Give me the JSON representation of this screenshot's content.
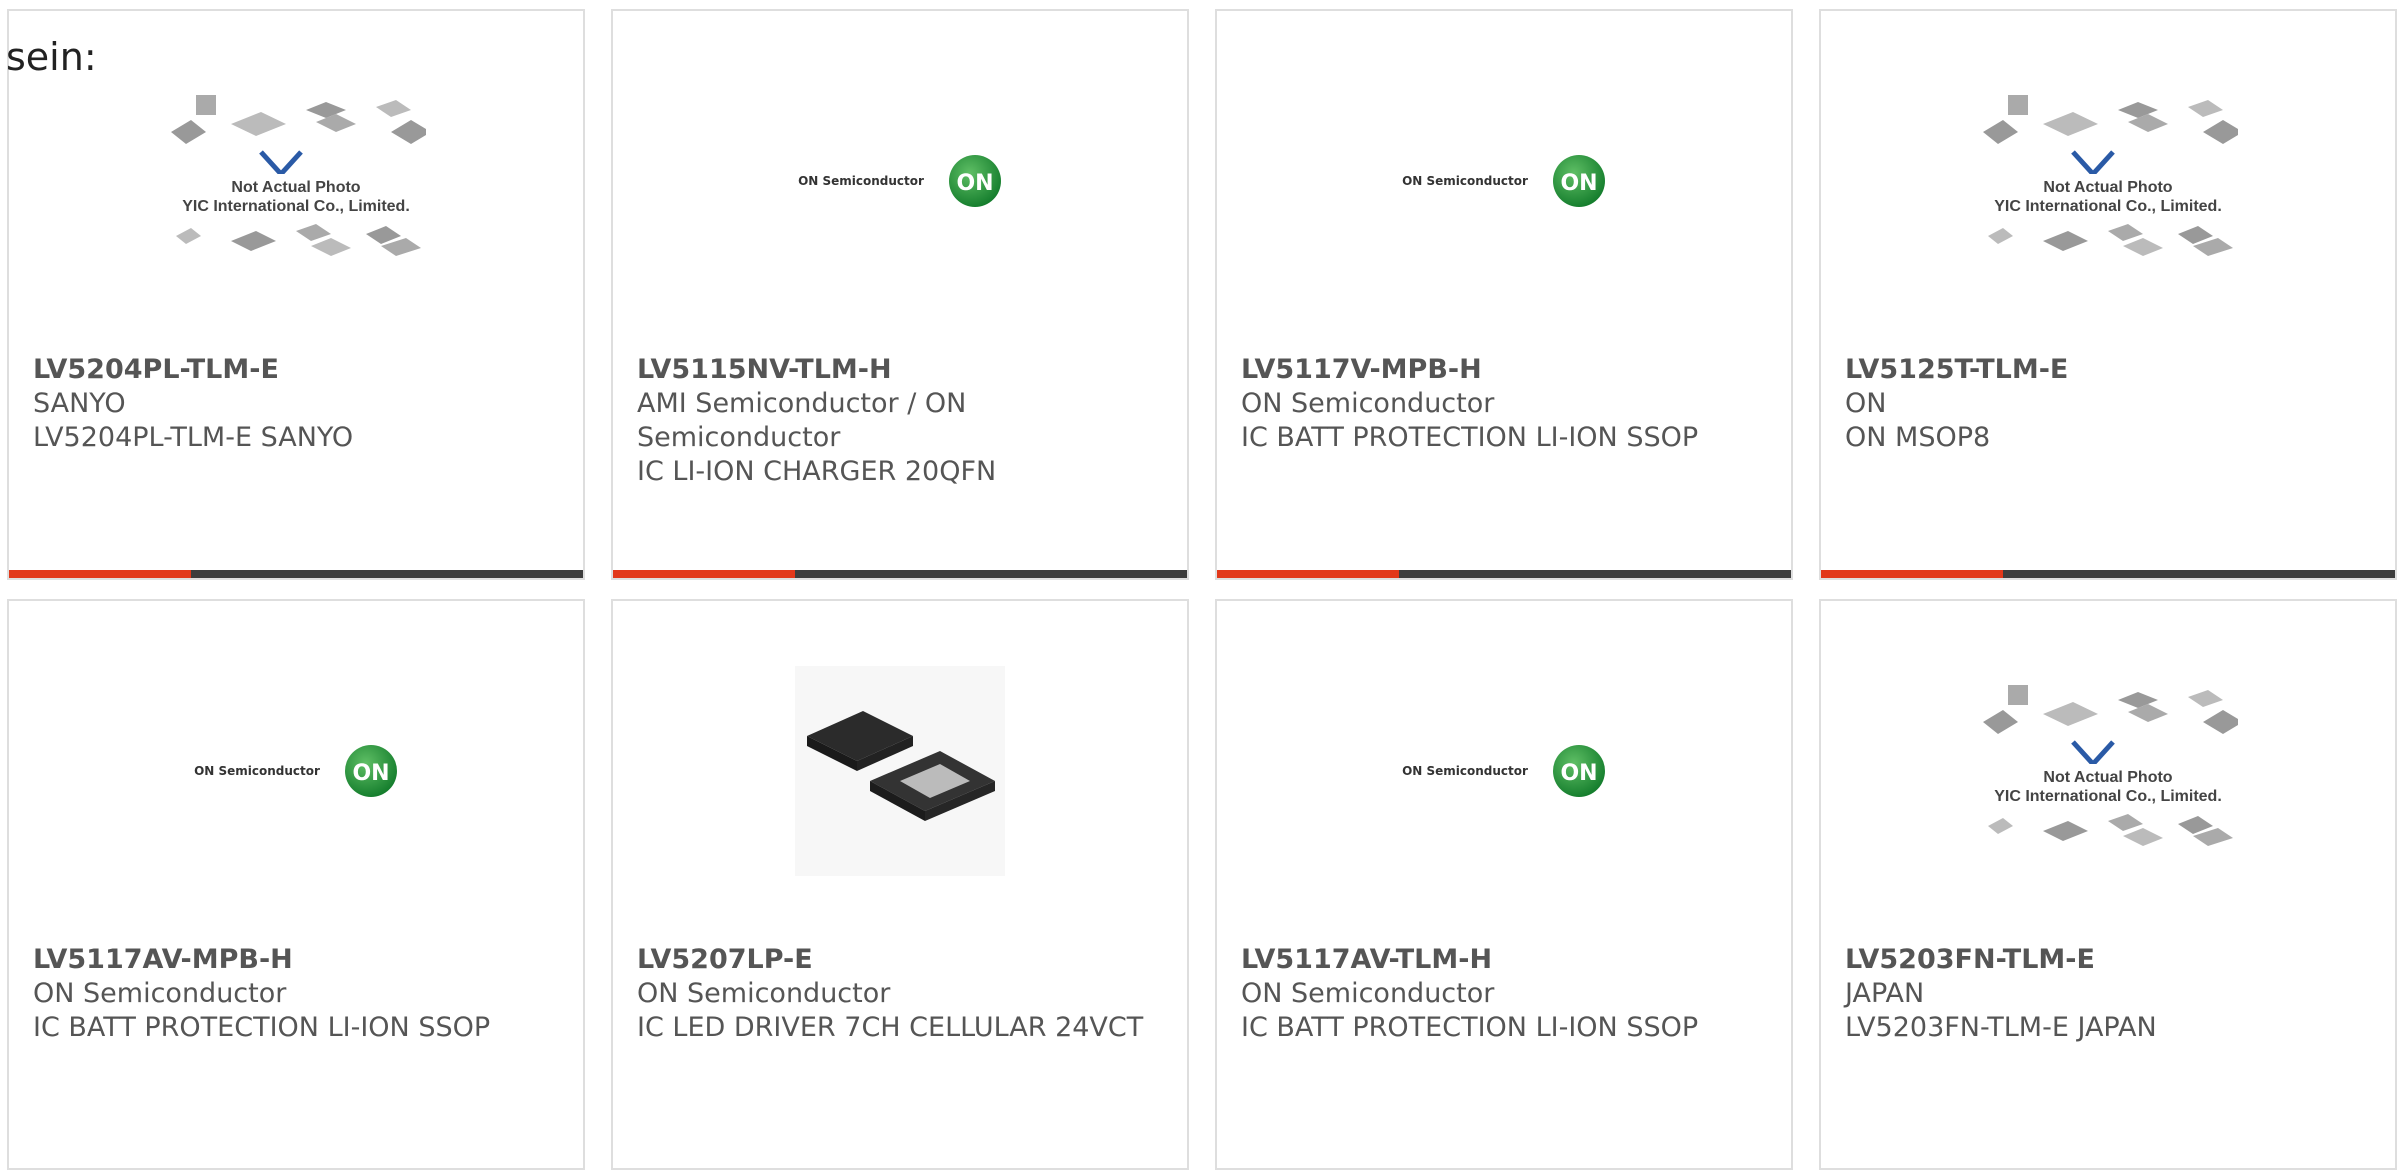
{
  "intro_text": "sein:",
  "placeholder": {
    "line1": "Not Actual Photo",
    "line2": "YIC International Co., Limited."
  },
  "on_logo": {
    "wordmark": "ON Semiconductor",
    "badge": "ON"
  },
  "colors": {
    "accent": "#e2381a",
    "bar": "#3d3d3d",
    "text": "#555555",
    "border": "#dedede"
  },
  "products": [
    {
      "part": "LV5204PL-TLM-E",
      "manufacturer": "SANYO",
      "description": "LV5204PL-TLM-E SANYO",
      "image": "placeholder"
    },
    {
      "part": "LV5115NV-TLM-H",
      "manufacturer": "AMI Semiconductor / ON Semiconductor",
      "description": "IC LI-ION CHARGER 20QFN",
      "image": "on-logo"
    },
    {
      "part": "LV5117V-MPB-H",
      "manufacturer": "ON Semiconductor",
      "description": "IC BATT PROTECTION LI-ION SSOP",
      "image": "on-logo"
    },
    {
      "part": "LV5125T-TLM-E",
      "manufacturer": "ON",
      "description": "ON MSOP8",
      "image": "placeholder"
    },
    {
      "part": "LV5117AV-MPB-H",
      "manufacturer": "ON Semiconductor",
      "description": "IC BATT PROTECTION LI-ION SSOP",
      "image": "on-logo"
    },
    {
      "part": "LV5207LP-E",
      "manufacturer": "ON Semiconductor",
      "description": "IC LED DRIVER 7CH CELLULAR 24VCT",
      "image": "chip-photo"
    },
    {
      "part": "LV5117AV-TLM-H",
      "manufacturer": "ON Semiconductor",
      "description": "IC BATT PROTECTION LI-ION SSOP",
      "image": "on-logo"
    },
    {
      "part": "LV5203FN-TLM-E",
      "manufacturer": "JAPAN",
      "description": "LV5203FN-TLM-E JAPAN",
      "image": "placeholder"
    }
  ]
}
